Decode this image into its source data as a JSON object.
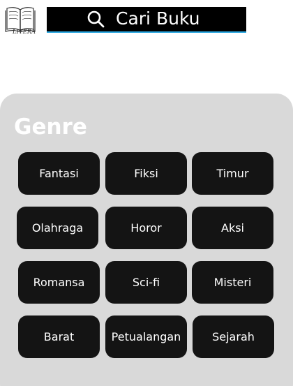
{
  "logo": {
    "icon": "open-book-icon",
    "text": "LITERA"
  },
  "search": {
    "icon": "search-icon",
    "label": "Cari Buku",
    "accent_color": "#2aa7e0"
  },
  "genre": {
    "title": "Genre",
    "items": [
      {
        "label": "Fantasi"
      },
      {
        "label": "Fiksi"
      },
      {
        "label": "Timur"
      },
      {
        "label": "Olahraga"
      },
      {
        "label": "Horor"
      },
      {
        "label": "Aksi"
      },
      {
        "label": "Romansa"
      },
      {
        "label": "Sci-fi"
      },
      {
        "label": "Misteri"
      },
      {
        "label": "Barat"
      },
      {
        "label": "Petualangan"
      },
      {
        "label": "Sejarah"
      }
    ]
  }
}
